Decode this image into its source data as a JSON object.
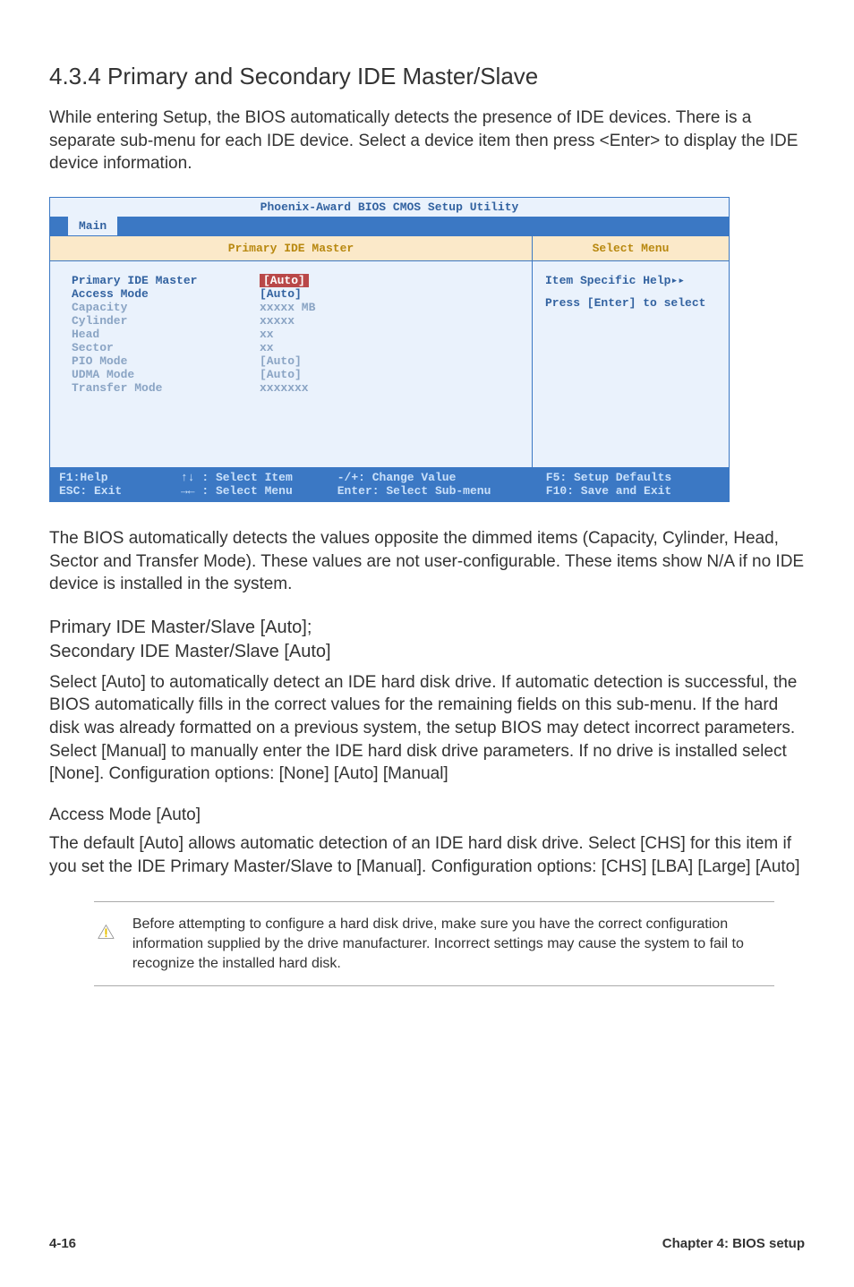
{
  "heading": "4.3.4    Primary and Secondary IDE Master/Slave",
  "intro": "While entering Setup, the BIOS automatically detects the presence of IDE devices. There is a separate sub-menu for each IDE device. Select a device item then press <Enter> to display the IDE device information.",
  "bios": {
    "title": "Phoenix-Award BIOS CMOS Setup Utility",
    "tab": "Main",
    "header_left": "Primary IDE Master",
    "header_right": "Select Menu",
    "rows": [
      {
        "label": "Primary IDE Master",
        "val": "Auto",
        "hl": true,
        "dim": false
      },
      {
        "label": "Access Mode",
        "val": "[Auto]",
        "hl": false,
        "dim": false
      },
      {
        "label": "",
        "val": "",
        "hl": false,
        "dim": false
      },
      {
        "label": "Capacity",
        "val": "xxxxx MB",
        "hl": false,
        "dim": true
      },
      {
        "label": "",
        "val": "",
        "hl": false,
        "dim": false
      },
      {
        "label": "Cylinder",
        "val": "xxxxx",
        "hl": false,
        "dim": true
      },
      {
        "label": "Head",
        "val": "   xx",
        "hl": false,
        "dim": true
      },
      {
        "label": "Sector",
        "val": "   xx",
        "hl": false,
        "dim": true
      },
      {
        "label": "PIO Mode",
        "val": "[Auto]",
        "hl": false,
        "dim": true
      },
      {
        "label": "UDMA Mode",
        "val": "[Auto]",
        "hl": false,
        "dim": true
      },
      {
        "label": "Transfer Mode",
        "val": "xxxxxxx",
        "hl": false,
        "dim": true
      }
    ],
    "help1": "Item Specific Help",
    "help2": "Press [Enter] to select",
    "footer": {
      "c1a": "F1:Help",
      "c1b": "ESC: Exit",
      "c2a": "↑↓ : Select Item",
      "c2b": "→← : Select Menu",
      "c3a": "-/+: Change Value",
      "c3b": "Enter: Select Sub-menu",
      "c4a": "F5: Setup Defaults",
      "c4b": "F10: Save and Exit"
    }
  },
  "para_after_bios": "The BIOS automatically detects the values opposite the dimmed items (Capacity, Cylinder,  Head, Sector and Transfer Mode). These values are not user-configurable. These items show N/A if no IDE device is installed in the system.",
  "sect1_h": "Primary IDE Master/Slave [Auto]; Secondary IDE Master/Slave [Auto]",
  "sect1_p": "Select [Auto] to automatically detect an IDE hard disk drive. If automatic detection is successful, the BIOS automatically fills in the correct values for the remaining fields on this sub-menu. If the hard disk was already formatted on a previous system, the setup BIOS may detect incorrect parameters. Select [Manual] to manually enter the IDE hard disk drive parameters. If no drive is installed select [None]. Configuration options: [None] [Auto] [Manual]",
  "sect2_h": "Access Mode [Auto]",
  "sect2_p": "The default [Auto] allows automatic detection of an IDE hard disk drive. Select [CHS] for this item if you set the IDE Primary Master/Slave to [Manual]. Configuration options: [CHS] [LBA] [Large] [Auto]",
  "note": "Before attempting to configure a hard disk drive, make sure you have the correct configuration information supplied by the drive manufacturer. Incorrect settings may cause the system to fail to recognize the installed hard disk.",
  "footer_left": "4-16",
  "footer_right": "Chapter 4: BIOS setup"
}
